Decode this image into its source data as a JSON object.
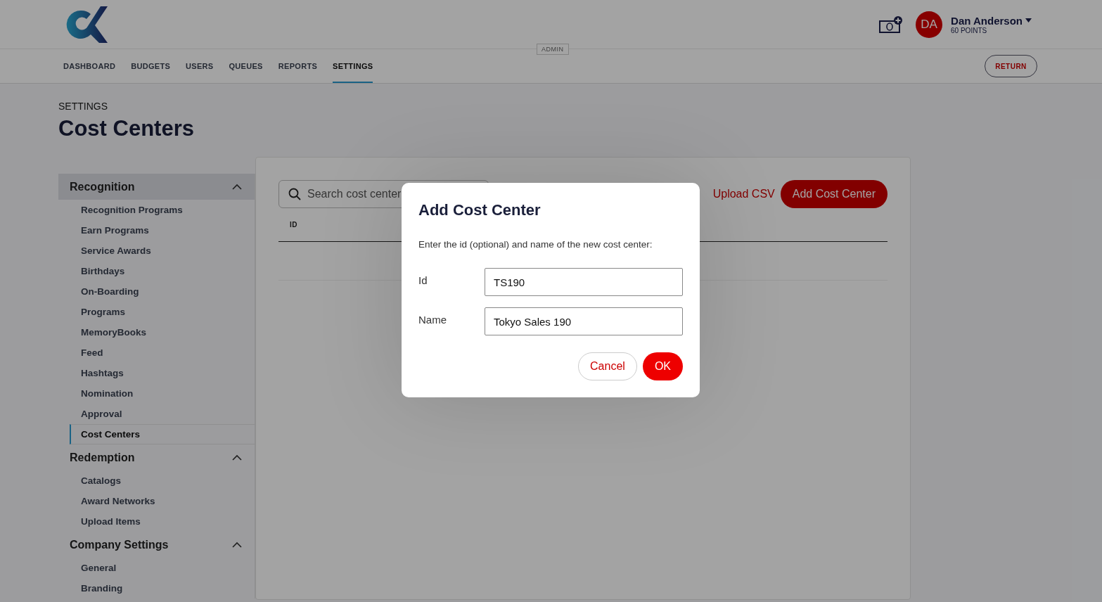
{
  "header": {
    "user": {
      "initials": "DA",
      "name": "Dan Anderson",
      "points": "60 POINTS"
    }
  },
  "nav": {
    "tabs": [
      {
        "label": "DASHBOARD",
        "selected": false
      },
      {
        "label": "BUDGETS",
        "selected": false
      },
      {
        "label": "USERS",
        "selected": false
      },
      {
        "label": "QUEUES",
        "selected": false
      },
      {
        "label": "REPORTS",
        "selected": false
      },
      {
        "label": "SETTINGS",
        "selected": true
      }
    ],
    "badge": "ADMIN",
    "return_button": "RETURN"
  },
  "page": {
    "breadcrumb": "SETTINGS",
    "title": "Cost Centers"
  },
  "sidebar": {
    "sections": [
      {
        "label": "Recognition",
        "expanded": true,
        "highlighted": true,
        "items": [
          {
            "label": "Recognition Programs",
            "selected": false
          },
          {
            "label": "Earn Programs",
            "selected": false
          },
          {
            "label": "Service Awards",
            "selected": false
          },
          {
            "label": "Birthdays",
            "selected": false
          },
          {
            "label": "On-Boarding",
            "selected": false
          },
          {
            "label": "Programs",
            "selected": false
          },
          {
            "label": "MemoryBooks",
            "selected": false
          },
          {
            "label": "Feed",
            "selected": false
          },
          {
            "label": "Hashtags",
            "selected": false
          },
          {
            "label": "Nomination",
            "selected": false
          },
          {
            "label": "Approval",
            "selected": false
          },
          {
            "label": "Cost Centers",
            "selected": true
          }
        ]
      },
      {
        "label": "Redemption",
        "expanded": true,
        "highlighted": false,
        "items": [
          {
            "label": "Catalogs",
            "selected": false
          },
          {
            "label": "Award Networks",
            "selected": false
          },
          {
            "label": "Upload Items",
            "selected": false
          }
        ]
      },
      {
        "label": "Company Settings",
        "expanded": true,
        "highlighted": false,
        "items": [
          {
            "label": "General",
            "selected": false
          },
          {
            "label": "Branding",
            "selected": false
          }
        ]
      }
    ]
  },
  "panel": {
    "search": {
      "placeholder": "Search cost center"
    },
    "upload_link": "Upload CSV",
    "add_button": "Add Cost Center",
    "table": {
      "columns": [
        "ID"
      ]
    }
  },
  "dialog": {
    "title": "Add Cost Center",
    "instructions": "Enter the id (optional) and name of the new cost center:",
    "fields": [
      {
        "label": "Id",
        "value": "TS190"
      },
      {
        "label": "Name",
        "value": "Tokyo Sales 190"
      }
    ],
    "cancel_button": "Cancel",
    "ok_button": "OK"
  }
}
